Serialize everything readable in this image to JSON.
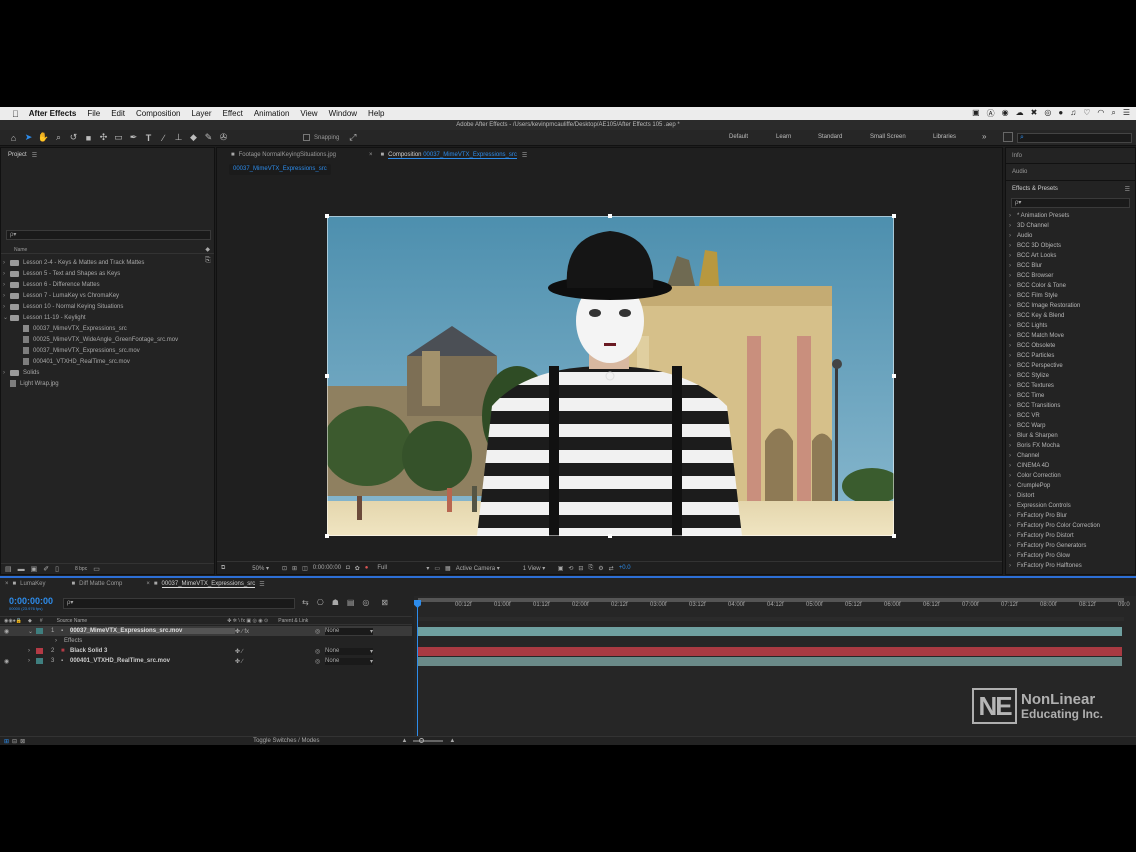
{
  "menubar": {
    "app": "After Effects",
    "items": [
      "File",
      "Edit",
      "Composition",
      "Layer",
      "Effect",
      "Animation",
      "View",
      "Window",
      "Help"
    ]
  },
  "window_title": "Adobe After Effects - /Users/kevinpmcauliffe/Desktop/AE105/After Effects 105 .aep *",
  "toolbar": {
    "snapping": "Snapping",
    "workspaces": [
      "Default",
      "Learn",
      "Standard",
      "Small Screen",
      "Libraries"
    ]
  },
  "project": {
    "title": "Project",
    "search_placeholder": "ρ▾",
    "name_header": "Name",
    "items": [
      {
        "label": "Lesson 2-4 - Keys & Mattes and Track Mattes",
        "type": "folder",
        "indent": 0
      },
      {
        "label": "Lesson 5 - Text and Shapes as Keys",
        "type": "folder",
        "indent": 0
      },
      {
        "label": "Lesson 6 - Difference Mattes",
        "type": "folder",
        "indent": 0
      },
      {
        "label": "Lesson 7 - LumaKey vs ChromaKey",
        "type": "folder",
        "indent": 0
      },
      {
        "label": "Lesson 10 - Normal Keying Situations",
        "type": "folder",
        "indent": 0
      },
      {
        "label": "Lesson 11-19 - Keylight",
        "type": "folder-open",
        "indent": 0
      },
      {
        "label": "00037_MimeVTX_Expressions_src",
        "type": "comp",
        "indent": 1
      },
      {
        "label": "00025_MimeVTX_WideAngle_GreenFootage_src.mov",
        "type": "file",
        "indent": 1
      },
      {
        "label": "00037_MimeVTX_Expressions_src.mov",
        "type": "file",
        "indent": 1
      },
      {
        "label": "000401_VTXHD_RealTime_src.mov",
        "type": "file",
        "indent": 1
      },
      {
        "label": "Solids",
        "type": "folder",
        "indent": 0
      },
      {
        "label": "Light Wrap.jpg",
        "type": "file",
        "indent": 0
      }
    ],
    "bpc": "8 bpc"
  },
  "viewer": {
    "tabs": [
      {
        "label": "Footage NormalKeyingSituations.jpg",
        "active": false
      },
      {
        "prefix": "Composition",
        "label": "00037_MimeVTX_Expressions_src",
        "active": true
      }
    ],
    "breadcrumb": "00037_MimeVTX_Expressions_src",
    "footer": {
      "zoom": "50%",
      "timecode": "0:00:00:00",
      "resolution": "Full",
      "camera": "Active Camera",
      "views": "1 View",
      "exposure": "+0.0"
    }
  },
  "right_panels": {
    "info": "Info",
    "audio": "Audio",
    "effects_title": "Effects & Presets",
    "search_placeholder": "ρ▾",
    "items": [
      "* Animation Presets",
      "3D Channel",
      "Audio",
      "BCC 3D Objects",
      "BCC Art Looks",
      "BCC Blur",
      "BCC Browser",
      "BCC Color & Tone",
      "BCC Film Style",
      "BCC Image Restoration",
      "BCC Key & Blend",
      "BCC Lights",
      "BCC Match Move",
      "BCC Obsolete",
      "BCC Particles",
      "BCC Perspective",
      "BCC Stylize",
      "BCC Textures",
      "BCC Time",
      "BCC Transitions",
      "BCC VR",
      "BCC Warp",
      "Blur & Sharpen",
      "Boris FX Mocha",
      "Channel",
      "CINEMA 4D",
      "Color Correction",
      "CrumplePop",
      "Distort",
      "Expression Controls",
      "FxFactory Pro Blur",
      "FxFactory Pro Color Correction",
      "FxFactory Pro Distort",
      "FxFactory Pro Generators",
      "FxFactory Pro Glow",
      "FxFactory Pro Halftones"
    ]
  },
  "timeline": {
    "tabs": [
      {
        "label": "LumaKey",
        "active": false
      },
      {
        "label": "Diff Matte Comp",
        "active": false
      },
      {
        "label": "00037_MimeVTX_Expressions_src",
        "active": true
      }
    ],
    "timecode": "0:00:00:00",
    "subframes": "00000 (23.976 fps)",
    "search_placeholder": "ρ▾",
    "headers": {
      "source_name": "Source Name",
      "parent": "Parent & Link"
    },
    "layers": [
      {
        "num": "1",
        "name": "00037_MimeVTX_Expressions_src.mov",
        "color": "#3f7f7f",
        "parent": "None",
        "selected": true
      },
      {
        "num": "",
        "name": "Effects",
        "color": "",
        "parent": "",
        "selected": false
      },
      {
        "num": "2",
        "name": "Black Solid 3",
        "color": "#b33a45",
        "parent": "None",
        "selected": false
      },
      {
        "num": "3",
        "name": "000401_VTXHD_RealTime_src.mov",
        "color": "#3f7f7f",
        "parent": "None",
        "selected": false
      }
    ],
    "ruler": [
      "0f",
      "00:12f",
      "01:00f",
      "01:12f",
      "02:00f",
      "02:12f",
      "03:00f",
      "03:12f",
      "04:00f",
      "04:12f",
      "05:00f",
      "05:12f",
      "06:00f",
      "06:12f",
      "07:00f",
      "07:12f",
      "08:00f",
      "08:12f",
      "09:0"
    ],
    "toggle_label": "Toggle Switches / Modes"
  },
  "watermark": {
    "line1": "NonLinear",
    "line2": "Educating Inc."
  },
  "colors": {
    "accent": "#2d8ceb",
    "teal_bar": "#6fa0a0",
    "red_bar": "#a93a42"
  }
}
